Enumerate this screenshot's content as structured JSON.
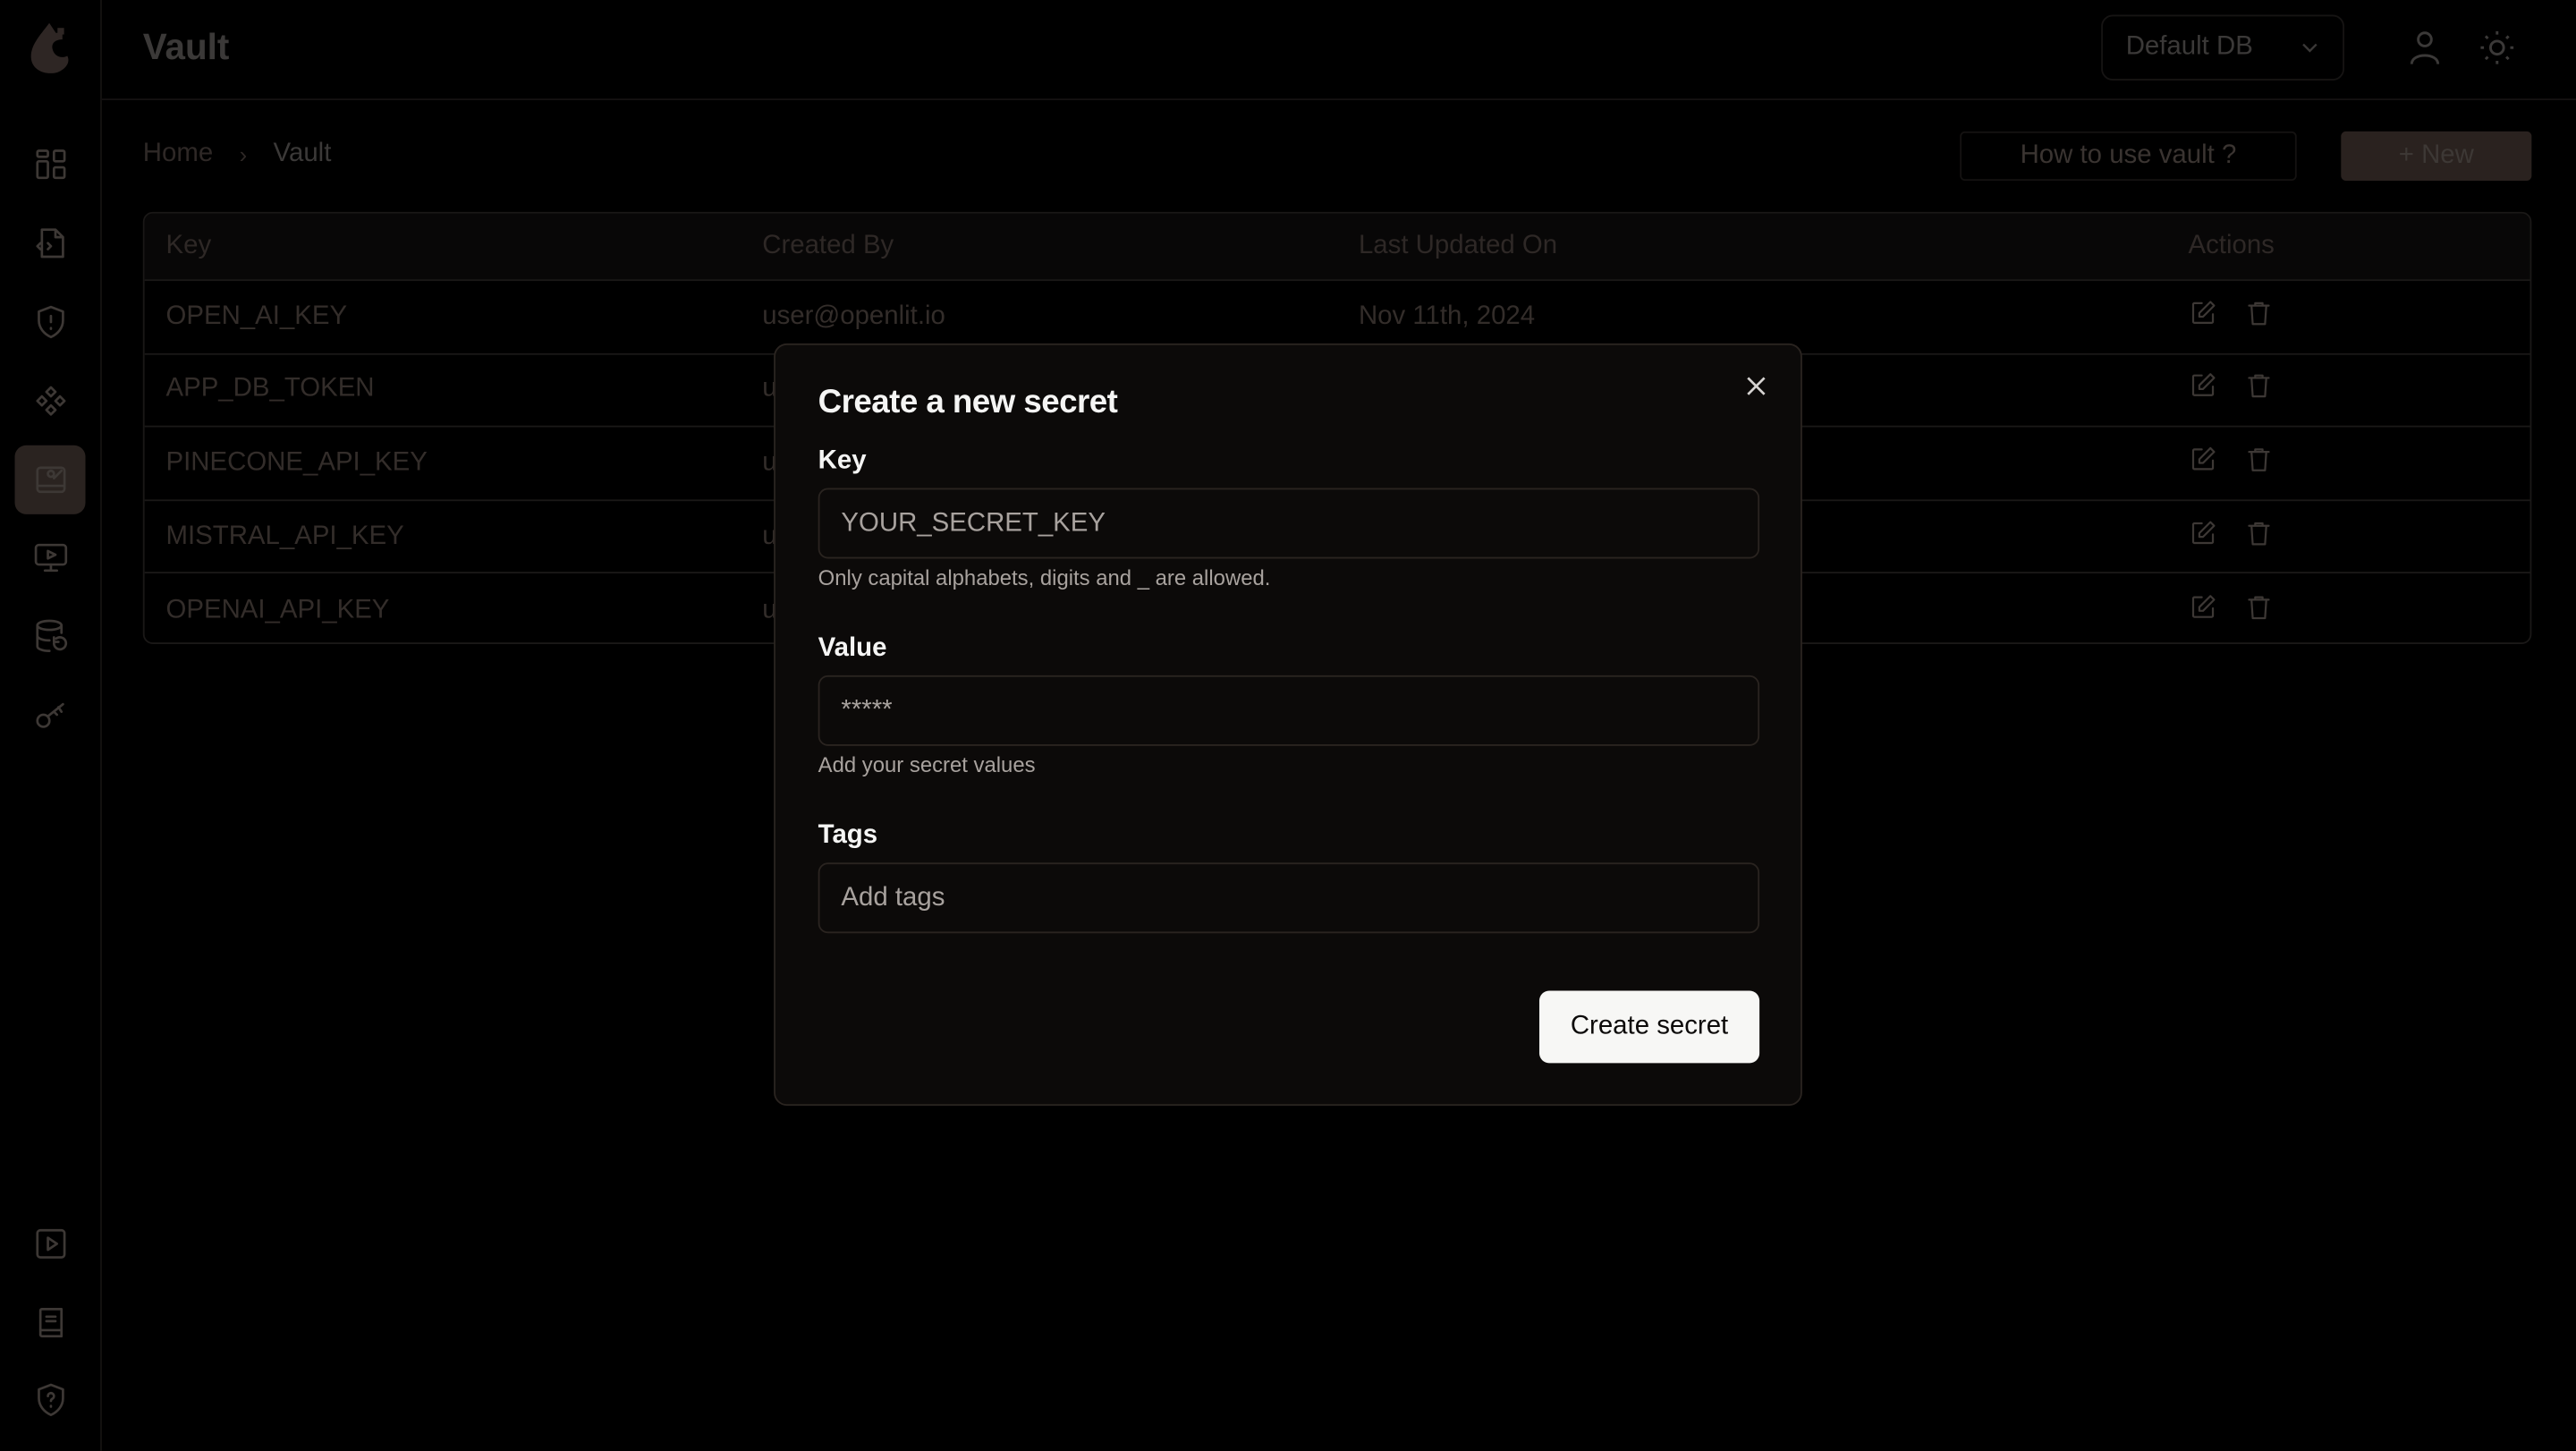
{
  "app": {
    "title": "Vault",
    "logo": "openlit-logo"
  },
  "sidebar": {
    "items": [
      {
        "name": "dashboard",
        "icon": "dashboard-icon",
        "active": false
      },
      {
        "name": "requests",
        "icon": "code-file-icon",
        "active": false
      },
      {
        "name": "exceptions",
        "icon": "shield-alert-icon",
        "active": false
      },
      {
        "name": "components",
        "icon": "components-icon",
        "active": false
      },
      {
        "name": "vault",
        "icon": "vault-icon",
        "active": true
      },
      {
        "name": "openground",
        "icon": "monitor-play-icon",
        "active": false
      },
      {
        "name": "database-config",
        "icon": "database-refresh-icon",
        "active": false
      },
      {
        "name": "api-keys",
        "icon": "key-icon",
        "active": false
      }
    ],
    "bottom": [
      {
        "name": "tutorial",
        "icon": "play-square-icon"
      },
      {
        "name": "docs",
        "icon": "book-icon"
      },
      {
        "name": "support",
        "icon": "shield-question-icon"
      }
    ]
  },
  "header": {
    "db_select": "Default DB",
    "user_icon": "user-icon",
    "theme_icon": "sun-icon"
  },
  "breadcrumb": {
    "home": "Home",
    "current": "Vault"
  },
  "toolbar": {
    "help_label": "How to use vault ?",
    "new_label": "+ New"
  },
  "table": {
    "columns": [
      "Key",
      "Created By",
      "Last Updated On",
      "Actions"
    ],
    "rows": [
      {
        "key": "OPEN_AI_KEY",
        "created_by": "user@openlit.io",
        "updated": "Nov 11th, 2024"
      },
      {
        "key": "APP_DB_TOKEN",
        "created_by": "u",
        "updated": ""
      },
      {
        "key": "PINECONE_API_KEY",
        "created_by": "u",
        "updated": ""
      },
      {
        "key": "MISTRAL_API_KEY",
        "created_by": "u",
        "updated": ""
      },
      {
        "key": "OPENAI_API_KEY",
        "created_by": "u",
        "updated": ""
      }
    ]
  },
  "modal": {
    "title": "Create a new secret",
    "key_label": "Key",
    "key_placeholder": "YOUR_SECRET_KEY",
    "key_hint": "Only capital alphabets, digits and _ are allowed.",
    "value_label": "Value",
    "value_placeholder": "*****",
    "value_hint": "Add your secret values",
    "tags_label": "Tags",
    "tags_placeholder": "Add tags",
    "submit_label": "Create secret"
  },
  "colors": {
    "accent": "#2a221f",
    "modal_bg": "#0c0a09",
    "button_bg": "#f7f7f5"
  }
}
